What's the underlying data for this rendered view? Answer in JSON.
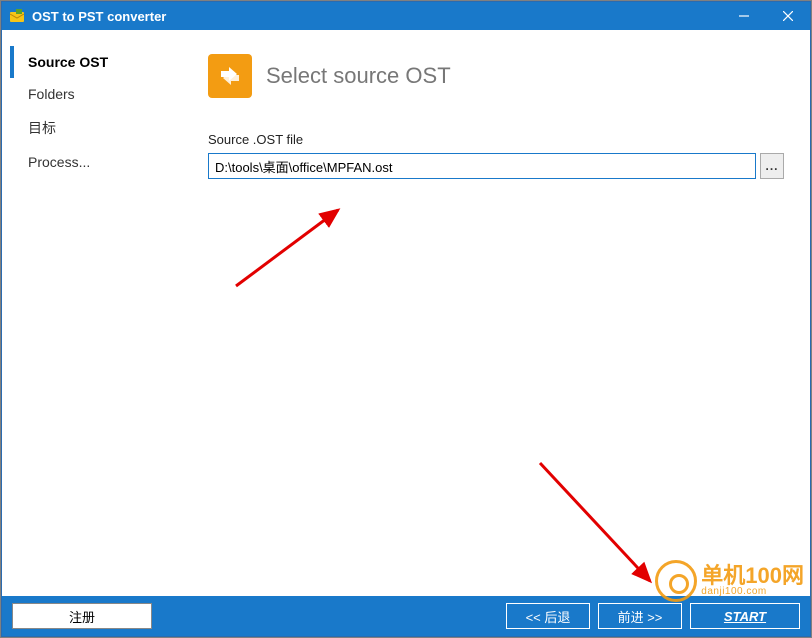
{
  "titlebar": {
    "title": "OST to PST converter"
  },
  "sidebar": {
    "items": [
      {
        "label": "Source OST",
        "active": true
      },
      {
        "label": "Folders",
        "active": false
      },
      {
        "label": "目标",
        "active": false
      },
      {
        "label": "Process...",
        "active": false
      }
    ]
  },
  "main": {
    "heading": "Select source OST",
    "field_label": "Source .OST file",
    "file_path": "D:\\tools\\桌面\\office\\MPFAN.ost",
    "browse_label": "..."
  },
  "footer": {
    "register": "注册",
    "back": "<< 后退",
    "next": "前进 >>",
    "start": "START"
  },
  "watermark": {
    "cn": "单机100网",
    "en": "danji100.com"
  }
}
